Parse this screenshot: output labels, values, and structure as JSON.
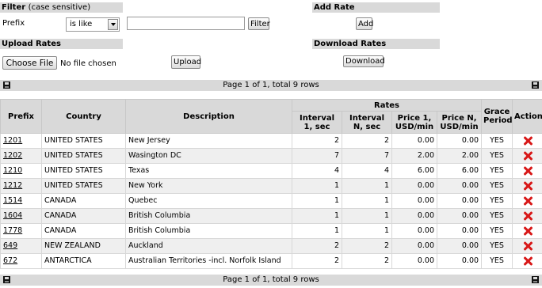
{
  "filter": {
    "title": "Filter",
    "subtitle": "(case sensitive)",
    "prefix_label": "Prefix",
    "operator": "is like",
    "value": "",
    "button": "Filter"
  },
  "add_rate": {
    "title": "Add Rate",
    "button": "Add"
  },
  "upload": {
    "title": "Upload Rates",
    "choose_button": "Choose File",
    "file_status": "No file chosen",
    "button": "Upload"
  },
  "download": {
    "title": "Download Rates",
    "button": "Download"
  },
  "pager": {
    "text": "Page 1 of 1, total 9 rows"
  },
  "table": {
    "headers": {
      "prefix": "Prefix",
      "country": "Country",
      "description": "Description",
      "rates": "Rates",
      "interval1": "Interval 1, sec",
      "intervalN": "Interval N, sec",
      "price1": "Price 1, USD/min",
      "priceN": "Price N, USD/min",
      "grace": "Grace Period",
      "action": "Action"
    },
    "rows": [
      {
        "prefix": "1201",
        "country": "UNITED STATES",
        "description": "New Jersey",
        "interval1": "2",
        "intervalN": "2",
        "price1": "0.00",
        "priceN": "0.00",
        "grace": "YES"
      },
      {
        "prefix": "1202",
        "country": "UNITED STATES",
        "description": "Wasington DC",
        "interval1": "7",
        "intervalN": "7",
        "price1": "2.00",
        "priceN": "2.00",
        "grace": "YES"
      },
      {
        "prefix": "1210",
        "country": "UNITED STATES",
        "description": "Texas",
        "interval1": "4",
        "intervalN": "4",
        "price1": "6.00",
        "priceN": "6.00",
        "grace": "YES"
      },
      {
        "prefix": "1212",
        "country": "UNITED STATES",
        "description": "New York",
        "interval1": "1",
        "intervalN": "1",
        "price1": "0.00",
        "priceN": "0.00",
        "grace": "YES"
      },
      {
        "prefix": "1514",
        "country": "CANADA",
        "description": "Quebec",
        "interval1": "1",
        "intervalN": "1",
        "price1": "0.00",
        "priceN": "0.00",
        "grace": "YES"
      },
      {
        "prefix": "1604",
        "country": "CANADA",
        "description": "British Columbia",
        "interval1": "1",
        "intervalN": "1",
        "price1": "0.00",
        "priceN": "0.00",
        "grace": "YES"
      },
      {
        "prefix": "1778",
        "country": "CANADA",
        "description": "British Columbia",
        "interval1": "1",
        "intervalN": "1",
        "price1": "0.00",
        "priceN": "0.00",
        "grace": "YES"
      },
      {
        "prefix": "649",
        "country": "NEW ZEALAND",
        "description": "Auckland",
        "interval1": "2",
        "intervalN": "2",
        "price1": "0.00",
        "priceN": "0.00",
        "grace": "YES"
      },
      {
        "prefix": "672",
        "country": "ANTARCTICA",
        "description": "Australian Territories -incl. Norfolk Island",
        "interval1": "2",
        "intervalN": "2",
        "price1": "0.00",
        "priceN": "0.00",
        "grace": "YES"
      }
    ],
    "delete_icon": "delete-icon",
    "delete_color": "#d81818"
  }
}
